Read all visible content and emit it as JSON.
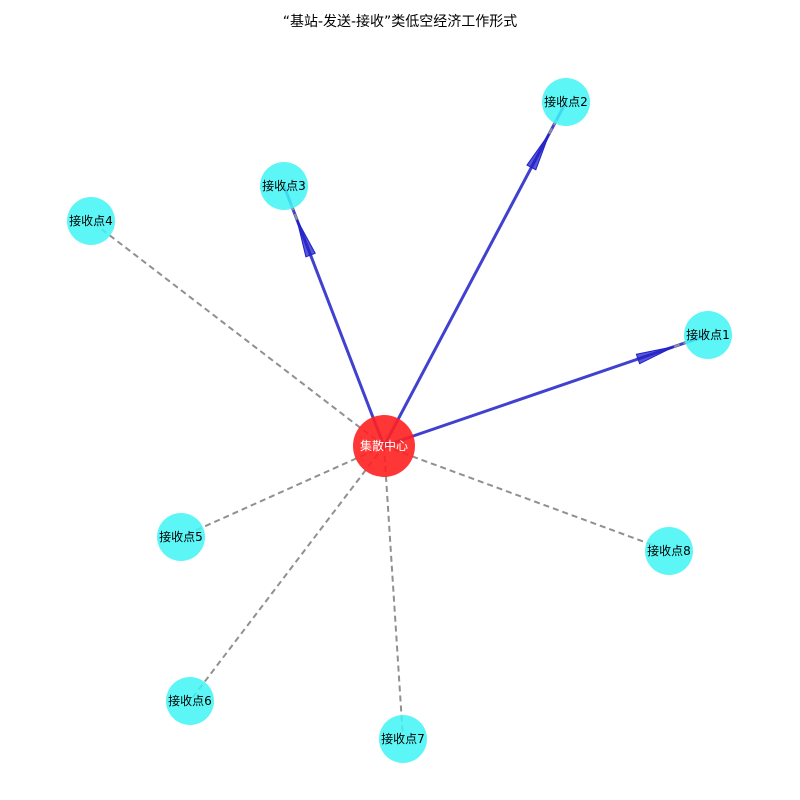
{
  "title": "“基站-发送-接收”类低空经济工作形式",
  "colors": {
    "hub_fill": "#ff2020",
    "node_fill": "#40f5f5",
    "active_edge": "#2020c8",
    "inactive_edge": "#909090",
    "hub_text": "#ffffff",
    "node_text": "#000000"
  },
  "hub": {
    "label": "集散中心"
  },
  "nodes": [
    {
      "label": "接收点1",
      "active": true
    },
    {
      "label": "接收点2",
      "active": true
    },
    {
      "label": "接收点3",
      "active": true
    },
    {
      "label": "接收点4",
      "active": false
    },
    {
      "label": "接收点5",
      "active": false
    },
    {
      "label": "接收点6",
      "active": false
    },
    {
      "label": "接收点7",
      "active": false
    },
    {
      "label": "接收点8",
      "active": false
    }
  ]
}
